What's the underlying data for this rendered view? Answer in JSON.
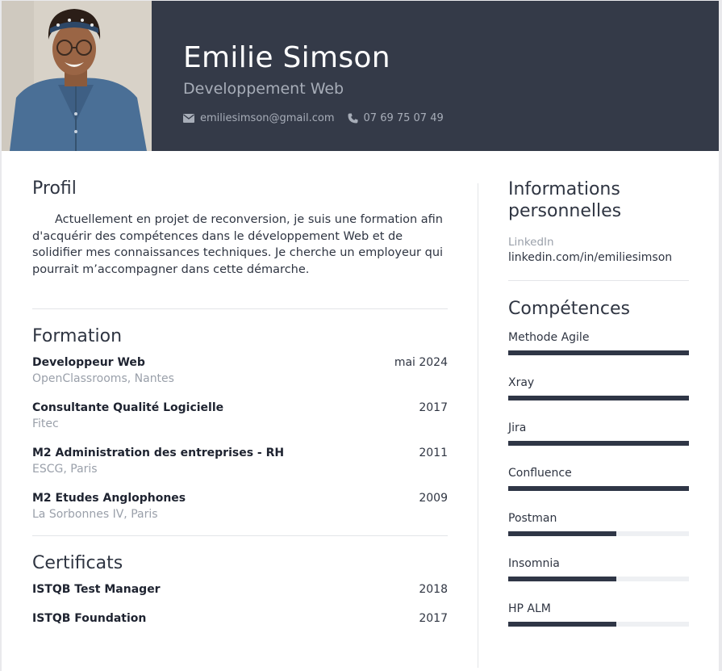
{
  "header": {
    "name": "Emilie Simson",
    "title": "Developpement Web",
    "email": "emiliesimson@gmail.com",
    "phone": "07 69 75 07 49",
    "email_icon": "envelope-icon",
    "phone_icon": "phone-icon",
    "background": "#343a48"
  },
  "profile": {
    "heading": "Profil",
    "text": "Actuellement en projet de reconversion, je suis une formation afin d'acquérir des compétences dans le développement Web et de solidifier mes connaissances techniques. Je cherche un employeur qui pourrait m’accompagner dans cette démarche."
  },
  "education": {
    "heading": "Formation",
    "items": [
      {
        "title": "Developpeur Web",
        "place": "OpenClassrooms, Nantes",
        "date": "mai 2024"
      },
      {
        "title": "Consultante Qualité Logicielle",
        "place": "Fitec",
        "date": "2017"
      },
      {
        "title": "M2 Administration des entreprises - RH",
        "place": "ESCG, Paris",
        "date": "2011"
      },
      {
        "title": "M2 Etudes Anglophones",
        "place": "La Sorbonnes IV, Paris",
        "date": "2009"
      }
    ]
  },
  "certificates": {
    "heading": "Certificats",
    "items": [
      {
        "title": "ISTQB Test Manager",
        "date": "2018"
      },
      {
        "title": "ISTQB Foundation",
        "date": "2017"
      }
    ]
  },
  "personal_info": {
    "heading": "Informations personnelles",
    "label": "LinkedIn",
    "value": "linkedin.com/in/emiliesimson"
  },
  "skills": {
    "heading": "Compétences",
    "items": [
      {
        "name": "Methode Agile",
        "level": 1.0
      },
      {
        "name": "Xray",
        "level": 1.0
      },
      {
        "name": "Jira",
        "level": 1.0
      },
      {
        "name": "Confluence",
        "level": 1.0
      },
      {
        "name": "Postman",
        "level": 0.6
      },
      {
        "name": "Insomnia",
        "level": 0.6
      },
      {
        "name": "HP ALM",
        "level": 0.6
      }
    ]
  }
}
